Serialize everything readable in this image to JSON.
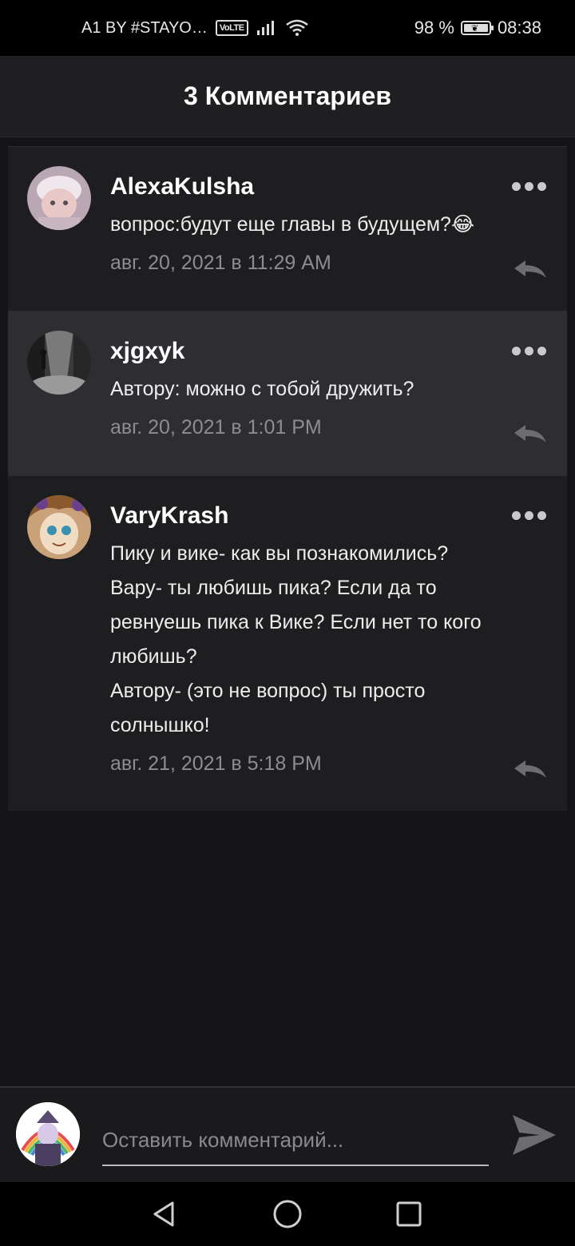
{
  "status_bar": {
    "carrier": "A1 BY #STAYO…",
    "volte": "VoLTE",
    "battery": "98 %",
    "time": "08:38"
  },
  "header": {
    "title": "3 Комментариев"
  },
  "comments": [
    {
      "username": "AlexaKulsha",
      "text": "вопрос:будут еще главы в будущем?😂",
      "date": "авг. 20, 2021 в 11:29 AM"
    },
    {
      "username": "xjgxyk",
      "text": "Автору: можно с тобой дружить?",
      "date": "авг. 20, 2021 в 1:01 PM"
    },
    {
      "username": "VaryKrash",
      "text_lines": [
        "Пику и вике- как вы познакомились?",
        "Вару- ты любишь пика? Если да то",
        "ревнуешь пика к Вике? Если нет то кого",
        "любишь?",
        "Автору- (это не вопрос) ты просто",
        "солнышко!"
      ],
      "date": "авг. 21, 2021 в 5:18 PM"
    }
  ],
  "composer": {
    "placeholder": "Оставить комментарий..."
  },
  "icons": {
    "more": "more-dots-icon",
    "reply": "reply-icon",
    "send": "send-icon",
    "back": "nav-back-icon",
    "home": "nav-home-icon",
    "recents": "nav-recents-icon"
  },
  "colors": {
    "background": "#141316",
    "card": "#1e1d20",
    "card_highlight": "#2e2d31",
    "muted_text": "#8d8c90"
  }
}
